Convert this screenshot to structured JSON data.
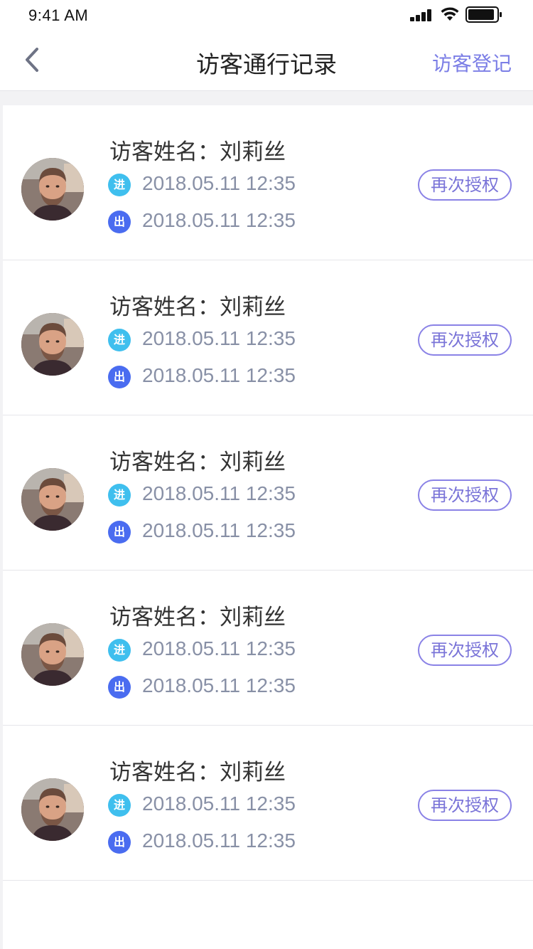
{
  "status_bar": {
    "time": "9:41 AM"
  },
  "nav": {
    "title": "访客通行记录",
    "action_label": "访客登记"
  },
  "visitors": [
    {
      "name_label": "访客姓名：刘莉丝",
      "in_badge": "进",
      "in_time": "2018.05.11 12:35",
      "out_badge": "出",
      "out_time": "2018.05.11 12:35",
      "button_label": "再次授权"
    },
    {
      "name_label": "访客姓名：刘莉丝",
      "in_badge": "进",
      "in_time": "2018.05.11 12:35",
      "out_badge": "出",
      "out_time": "2018.05.11 12:35",
      "button_label": "再次授权"
    },
    {
      "name_label": "访客姓名：刘莉丝",
      "in_badge": "进",
      "in_time": "2018.05.11 12:35",
      "out_badge": "出",
      "out_time": "2018.05.11 12:35",
      "button_label": "再次授权"
    },
    {
      "name_label": "访客姓名：刘莉丝",
      "in_badge": "进",
      "in_time": "2018.05.11 12:35",
      "out_badge": "出",
      "out_time": "2018.05.11 12:35",
      "button_label": "再次授权"
    },
    {
      "name_label": "访客姓名：刘莉丝",
      "in_badge": "进",
      "in_time": "2018.05.11 12:35",
      "out_badge": "出",
      "out_time": "2018.05.11 12:35",
      "button_label": "再次授权"
    }
  ],
  "colors": {
    "accent": "#7b7ee6",
    "badge_in": "#3fbfee",
    "badge_out": "#4a6cf0",
    "time_text": "#8890a6"
  },
  "icons": {
    "back": "chevron-left-icon",
    "signal": "signal-icon",
    "wifi": "wifi-icon",
    "battery": "battery-icon",
    "avatar": "avatar-photo"
  }
}
